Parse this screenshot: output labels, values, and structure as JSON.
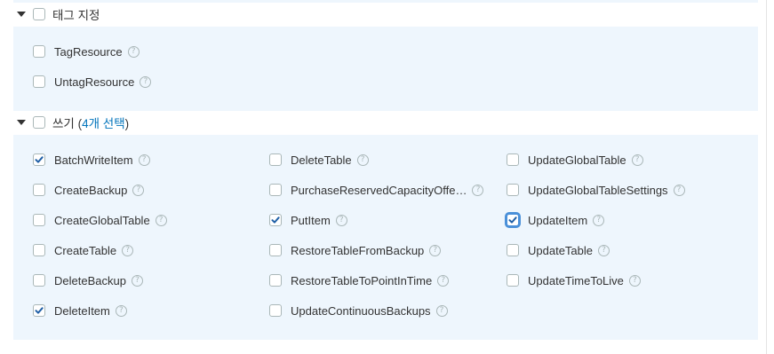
{
  "tag_group": {
    "title": "태그 지정",
    "items": [
      {
        "label": "TagResource",
        "checked": false
      },
      {
        "label": "UntagResource",
        "checked": false
      }
    ]
  },
  "write_group": {
    "title": "쓰기",
    "count_open": "(",
    "count_text": "4개 선택",
    "count_close": ")",
    "columns": [
      [
        {
          "label": "BatchWriteItem",
          "checked": true
        },
        {
          "label": "CreateBackup",
          "checked": false
        },
        {
          "label": "CreateGlobalTable",
          "checked": false
        },
        {
          "label": "CreateTable",
          "checked": false
        },
        {
          "label": "DeleteBackup",
          "checked": false
        },
        {
          "label": "DeleteItem",
          "checked": true
        }
      ],
      [
        {
          "label": "DeleteTable",
          "checked": false
        },
        {
          "label": "PurchaseReservedCapacityOffe…",
          "checked": false
        },
        {
          "label": "PutItem",
          "checked": true
        },
        {
          "label": "RestoreTableFromBackup",
          "checked": false
        },
        {
          "label": "RestoreTableToPointInTime",
          "checked": false
        },
        {
          "label": "UpdateContinuousBackups",
          "checked": false
        }
      ],
      [
        {
          "label": "UpdateGlobalTable",
          "checked": false
        },
        {
          "label": "UpdateGlobalTableSettings",
          "checked": false
        },
        {
          "label": "UpdateItem",
          "checked": true,
          "focused": true
        },
        {
          "label": "UpdateTable",
          "checked": false
        },
        {
          "label": "UpdateTimeToLive",
          "checked": false
        }
      ]
    ]
  },
  "help_glyph": "?",
  "colors": {
    "panel_bg": "#eef6fd",
    "accent": "#0073bb",
    "check": "#1f5fa6"
  }
}
